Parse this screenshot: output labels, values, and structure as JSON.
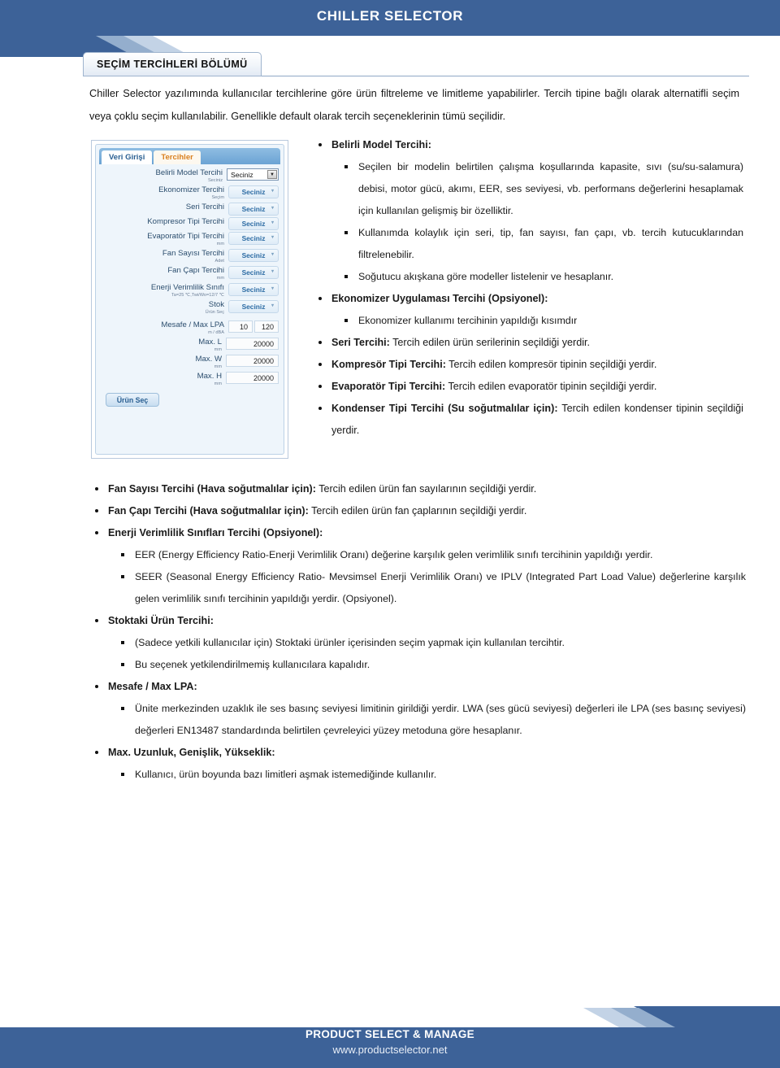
{
  "header": {
    "title": "CHILLER SELECTOR",
    "bar_color": "#3d6298"
  },
  "section_tab": {
    "label": "SEÇİM TERCİHLERİ BÖLÜMÜ"
  },
  "intro": {
    "paragraph": "Chiller Selector yazılımında kullanıcılar tercihlerine göre ürün filtreleme ve limitleme yapabilirler. Tercih tipine bağlı olarak alternatifli seçim veya çoklu seçim kullanılabilir. Genellikle default olarak tercih seçeneklerinin tümü seçilidir."
  },
  "appshot": {
    "tabs": [
      {
        "label": "Veri Girişi",
        "active": false
      },
      {
        "label": "Tercihler",
        "active": true
      }
    ],
    "rows": [
      {
        "label": "Belirli Model Tercihi",
        "sub": "Seciniz",
        "control": "select-white",
        "value": "Seciniz"
      },
      {
        "label": "Ekonomizer Tercihi",
        "sub": "Seçim",
        "control": "select-blue",
        "value": "Seciniz"
      },
      {
        "label": "Seri Tercihi",
        "sub": "",
        "control": "select-blue",
        "value": "Seciniz"
      },
      {
        "label": "Kompresor Tipi Tercihi",
        "sub": "",
        "control": "select-blue",
        "value": "Seciniz"
      },
      {
        "label": "Evaporatör Tipi Tercihi",
        "sub": "mm",
        "control": "select-blue",
        "value": "Seciniz"
      },
      {
        "label": "Fan Sayısı Tercihi",
        "sub": "Adet",
        "control": "select-blue",
        "value": "Seciniz"
      },
      {
        "label": "Fan Çapı Tercihi",
        "sub": "mm",
        "control": "select-blue",
        "value": "Seciniz"
      },
      {
        "label": "Enerji Verimlilik Sınıfı",
        "sub": "Ta=25 ℃,Twi/Wo=12/7 ℃",
        "control": "select-blue",
        "value": "Seciniz"
      },
      {
        "label": "Stok",
        "sub": "Ürün Seç",
        "control": "select-blue",
        "value": "Seciniz"
      },
      {
        "label": "Mesafe / Max LPA",
        "sub": "m / dBA",
        "control": "number-pair",
        "value": "10",
        "value2": "120"
      },
      {
        "label": "Max. L",
        "sub": "mm",
        "control": "number",
        "value": "20000"
      },
      {
        "label": "Max. W",
        "sub": "mm",
        "control": "number",
        "value": "20000"
      },
      {
        "label": "Max. H",
        "sub": "mm",
        "control": "number",
        "value": "20000"
      }
    ],
    "action_button": "Ürün Seç"
  },
  "side_bullets": {
    "b1_title": "Belirli Model Tercihi:",
    "b1_sub1": "Seçilen bir modelin belirtilen çalışma koşullarında kapasite, sıvı (su/su-salamura) debisi, motor gücü, akımı, EER, ses seviyesi, vb. performans değerlerini hesaplamak için kullanılan gelişmiş bir özelliktir.",
    "b1_sub2": "Kullanımda kolaylık için seri, tip, fan sayısı, fan çapı, vb. tercih kutucuklarından filtrelenebilir.",
    "b1_sub3": "Soğutucu akışkana göre modeller listelenir ve hesaplanır.",
    "b2_title": "Ekonomizer Uygulaması Tercihi (Opsiyonel):",
    "b2_sub1": "Ekonomizer kullanımı tercihinin yapıldığı kısımdır",
    "b3_bold": "Seri Tercihi:",
    "b3_rest": " Tercih edilen ürün serilerinin seçildiği yerdir.",
    "b4_bold": "Kompresör Tipi Tercihi:",
    "b4_rest": " Tercih edilen kompresör tipinin seçildiği yerdir.",
    "b5_bold": "Evaporatör Tipi Tercihi:",
    "b5_rest": " Tercih edilen evaporatör tipinin seçildiği yerdir.",
    "b6_bold": "Kondenser Tipi Tercihi (Su soğutmalılar için):",
    "b6_rest": "   Tercih edilen kondenser tipinin seçildiği yerdir."
  },
  "full_bullets": {
    "f1_bold": "Fan Sayısı Tercihi (Hava soğutmalılar için):",
    "f1_rest": " Tercih edilen ürün fan sayılarının seçildiği yerdir.",
    "f2_bold": "Fan Çapı Tercihi (Hava soğutmalılar için):",
    "f2_rest": " Tercih  edilen ürün fan çaplarının seçildiği yerdir.",
    "f3_title": "Enerji Verimlilik Sınıfları Tercihi (Opsiyonel):",
    "f3_sub1": "EER (Energy Efficiency Ratio-Enerji Verimlilik Oranı) değerine karşılık gelen verimlilik sınıfı tercihinin yapıldığı yerdir.",
    "f3_sub2": "SEER (Seasonal Energy Efficiency Ratio- Mevsimsel Enerji Verimlilik Oranı) ve IPLV (Integrated Part Load Value) değerlerine karşılık gelen verimlilik sınıfı tercihinin yapıldığı yerdir. (Opsiyonel).",
    "f4_title": "Stoktaki Ürün Tercihi:",
    "f4_sub1": "(Sadece yetkili kullanıcılar için) Stoktaki ürünler içerisinden seçim yapmak için kullanılan tercihtir.",
    "f4_sub2": "Bu seçenek yetkilendirilmemiş kullanıcılara kapalıdır.",
    "f5_title": "Mesafe / Max LPA:",
    "f5_sub1": "Ünite merkezinden uzaklık ile ses basınç seviyesi limitinin girildiği yerdir. LWA (ses gücü seviyesi) değerleri ile LPA (ses basınç seviyesi) değerleri  EN13487 standardında belirtilen çevreleyici yüzey metoduna göre hesaplanır.",
    "f6_title": "Max. Uzunluk, Genişlik, Yükseklik:",
    "f6_sub1": "Kullanıcı, ürün boyunda bazı limitleri aşmak istemediğinde kullanılır."
  },
  "footer": {
    "title": "PRODUCT SELECT & MANAGE",
    "url": "www.productselector.net"
  }
}
